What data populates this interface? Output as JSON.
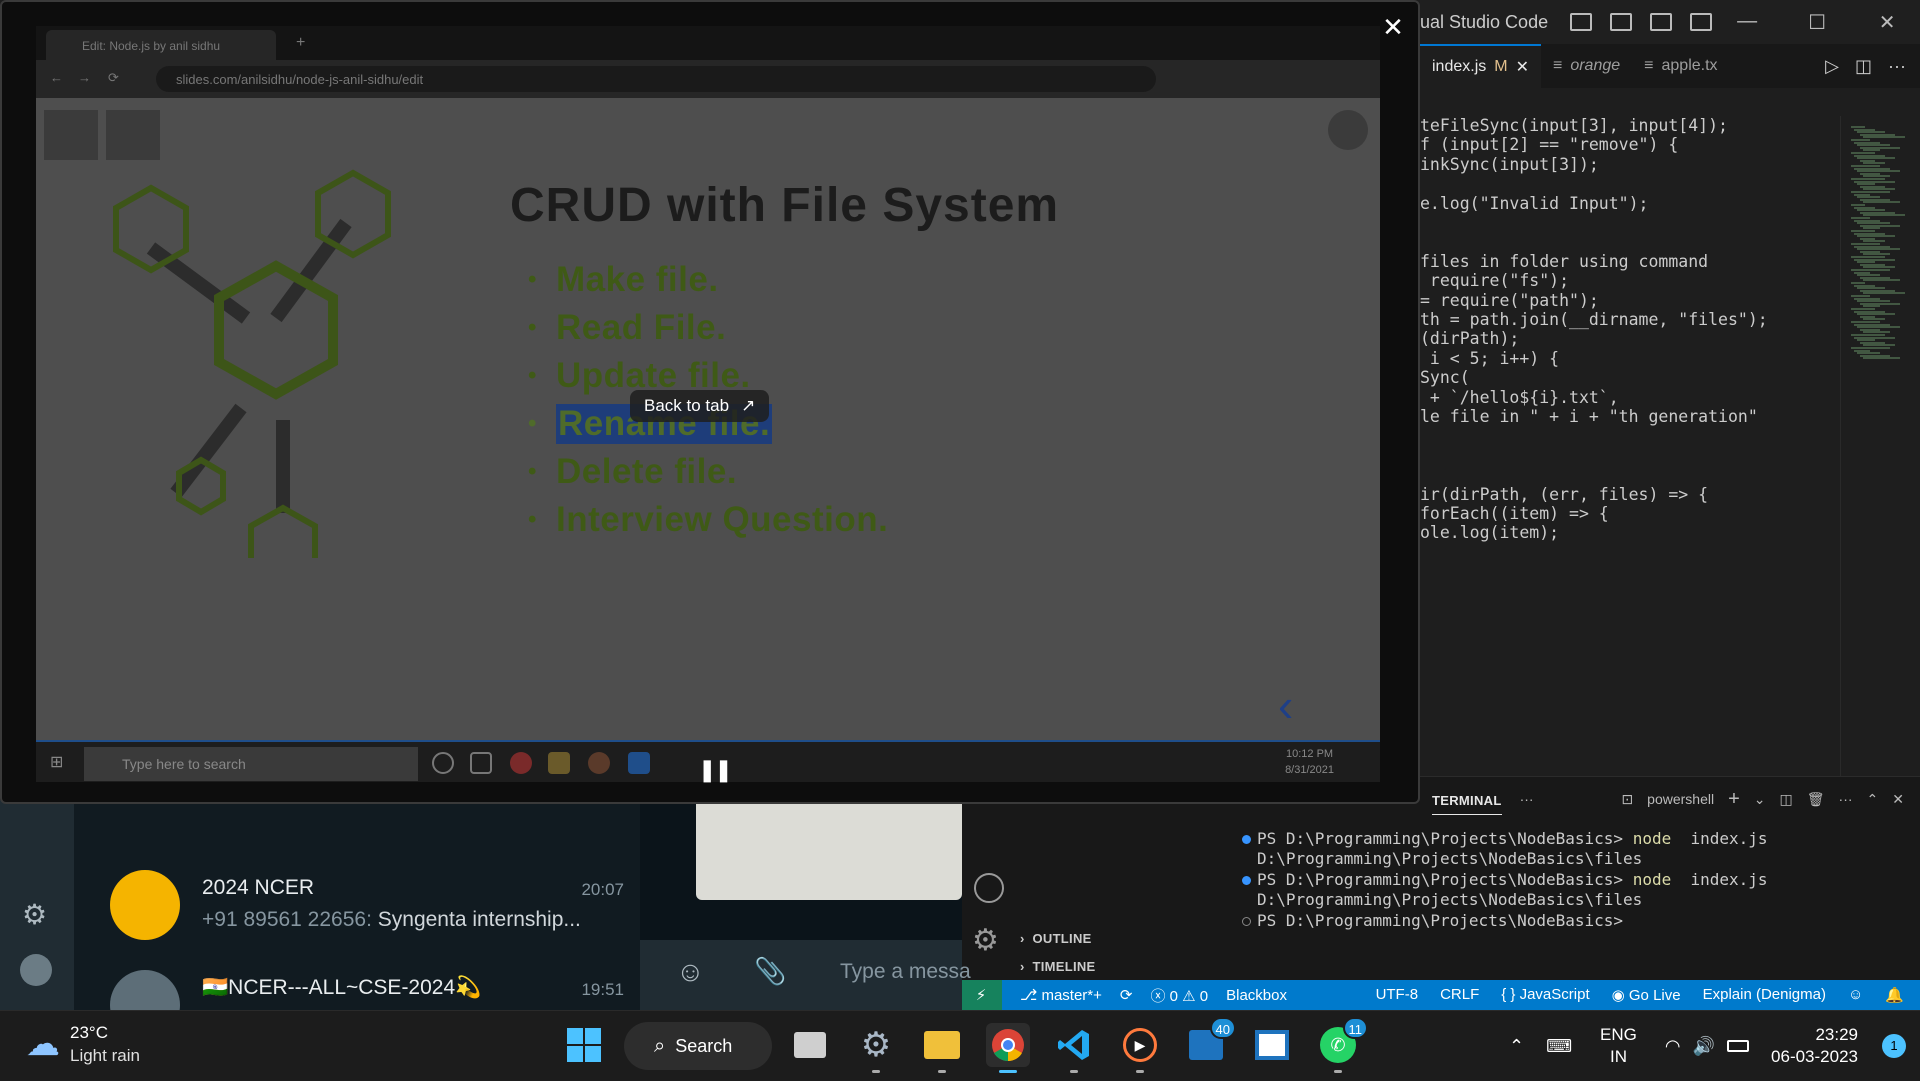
{
  "vscode": {
    "title": "ual Studio Code",
    "tabs": [
      {
        "label": "index.js",
        "modified": "M",
        "active": true
      },
      {
        "label": "orange",
        "active": false
      },
      {
        "label": "apple.tx",
        "active": false
      }
    ],
    "code_lines": [
      "teFileSync(input[3], input[4]);",
      "f (input[2] == \"remove\") {",
      "inkSync(input[3]);",
      "",
      "e.log(\"Invalid Input\");",
      "",
      "",
      "files in folder using command",
      " require(\"fs\");",
      "= require(\"path\");",
      "th = path.join(__dirname, \"files\");",
      "(dirPath);",
      " i < 5; i++) {",
      "Sync(",
      " + `/hello${i}.txt`,",
      "le file in \" + i + \"th generation\"",
      "",
      "",
      "",
      "ir(dirPath, (err, files) => {",
      "forEach((item) => {",
      "ole.log(item);"
    ],
    "panel": {
      "tab": "TERMINAL",
      "shell": "powershell",
      "lines": [
        {
          "prompt": "PS D:\\Programming\\Projects\\NodeBasics>",
          "cmd": "node",
          "arg": "index.js"
        },
        {
          "output": "D:\\Programming\\Projects\\NodeBasics\\files"
        },
        {
          "prompt": "PS D:\\Programming\\Projects\\NodeBasics>",
          "cmd": "node",
          "arg": "index.js"
        },
        {
          "output": "D:\\Programming\\Projects\\NodeBasics\\files"
        },
        {
          "prompt": "PS D:\\Programming\\Projects\\NodeBasics>",
          "cmd": "",
          "arg": ""
        }
      ]
    },
    "sidebar": {
      "outline": "OUTLINE",
      "timeline": "TIMELINE"
    },
    "statusbar": {
      "branch": "master*+",
      "problems": "ⓧ 0 ⚠ 0",
      "extension": "Blackbox",
      "encoding": "UTF-8",
      "eol": "CRLF",
      "language": "{ } JavaScript",
      "golive": "Go Live",
      "explain": "Explain (Denigma)"
    }
  },
  "whatsapp": {
    "chats": [
      {
        "name": "2024 NCER",
        "time": "20:07",
        "sender": "+91 89561 22656:",
        "message": "Syngenta internship..."
      },
      {
        "name": "🇮🇳NCER---ALL~CSE-2024💫",
        "time": "19:51",
        "sender": "",
        "message": ""
      }
    ],
    "compose_placeholder": "Type a messa"
  },
  "pip": {
    "browser_tab": "Edit: Node.js by anil sidhu",
    "url": "slides.com/anilsidhu/node-js-anil-sidhu/edit",
    "slide_title": "CRUD with File System",
    "bullets": [
      "Make file.",
      "Read File.",
      "Update file.",
      "Rename file.",
      "Delete file.",
      "Interview Question."
    ],
    "selected_bullet": 3,
    "back_to_tab": "Back to tab",
    "inner_search": "Type here to search",
    "inner_time": "10:12 PM",
    "inner_date": "8/31/2021"
  },
  "taskbar": {
    "weather_temp": "23°C",
    "weather_desc": "Light rain",
    "search": "Search",
    "badge_mail": "40",
    "badge_whatsapp": "11",
    "lang1": "ENG",
    "lang2": "IN",
    "time": "23:29",
    "date": "06-03-2023",
    "notifications": "1"
  }
}
